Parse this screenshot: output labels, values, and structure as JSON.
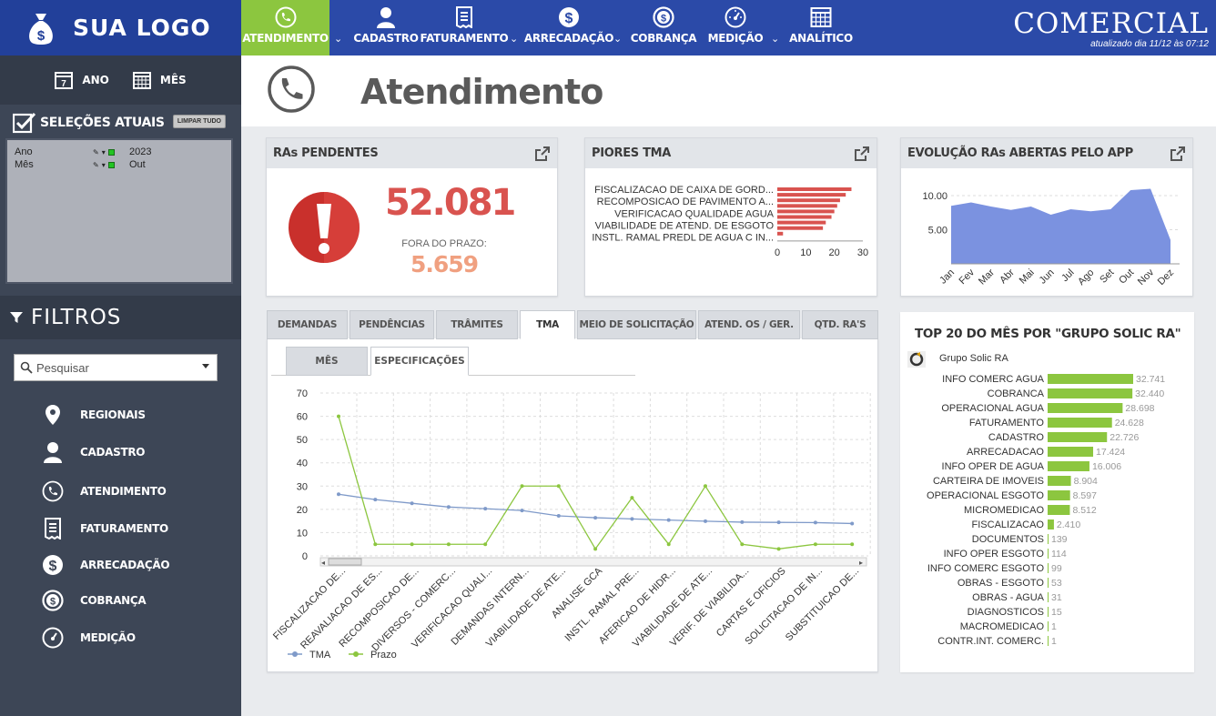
{
  "logo": {
    "text": "SUA LOGO"
  },
  "nav": {
    "items": [
      {
        "label": "ATENDIMENTO",
        "icon": "phone-icon",
        "active": true
      },
      {
        "label": "CADASTRO",
        "icon": "user-icon"
      },
      {
        "label": "FATURAMENTO",
        "icon": "receipt-icon"
      },
      {
        "label": "ARRECADAÇÃO",
        "icon": "dollar-icon"
      },
      {
        "label": "COBRANÇA",
        "icon": "dollar-cycle-icon"
      },
      {
        "label": "MEDIÇÃO",
        "icon": "gauge-icon"
      },
      {
        "label": "ANALÍTICO",
        "icon": "calendar-grid-icon"
      }
    ]
  },
  "app": {
    "title": "COMERCIAL",
    "updated": "atualizado dia 11/12 às 07:12"
  },
  "sidebar": {
    "ano": "ANO",
    "mes": "MÊS",
    "selections_title": "SELEÇÕES ATUAIS",
    "clear_label": "LIMPAR TUDO",
    "selections": [
      {
        "field": "Ano",
        "value": "2023"
      },
      {
        "field": "Mês",
        "value": "Out"
      }
    ],
    "filters_title": "FILTROS",
    "search_placeholder": "Pesquisar",
    "filters": [
      {
        "label": "REGIONAIS",
        "icon": "map-pin-icon"
      },
      {
        "label": "CADASTRO",
        "icon": "user-icon"
      },
      {
        "label": "ATENDIMENTO",
        "icon": "phone-icon"
      },
      {
        "label": "FATURAMENTO",
        "icon": "receipt-icon"
      },
      {
        "label": "ARRECADAÇÃO",
        "icon": "dollar-icon"
      },
      {
        "label": "COBRANÇA",
        "icon": "dollar-cycle-icon"
      },
      {
        "label": "MEDIÇÃO",
        "icon": "gauge-icon"
      }
    ]
  },
  "page": {
    "title": "Atendimento"
  },
  "kpi": {
    "title": "RAs PENDENTES",
    "value": "52.081",
    "sub_label": "FORA DO PRAZO:",
    "sub_value": "5.659"
  },
  "piores": {
    "title": "PIORES TMA"
  },
  "evolucao": {
    "title": "EVOLUÇÃO RAs ABERTAS PELO APP"
  },
  "tabs": [
    "DEMANDAS",
    "PENDÊNCIAS",
    "TRÂMITES",
    "TMA",
    "MEIO DE SOLICITAÇÃO",
    "ATEND. OS / GER.",
    "QTD. RA'S"
  ],
  "subtabs": [
    "MÊS",
    "ESPECIFICAÇÕES"
  ],
  "top20": {
    "title": "TOP 20 DO MÊS POR \"GRUPO SOLIC RA\"",
    "dimension": "Grupo Solic RA"
  },
  "colors": {
    "brand": "#2b4aa8",
    "accent": "#8cc63f",
    "alert": "#d9534f",
    "line_tma": "#7f9ac9",
    "area": "#7b92e0"
  },
  "chart_data": [
    {
      "type": "bar",
      "orientation": "horizontal",
      "title": "PIORES TMA",
      "categories": [
        "FISCALIZACAO DE CAIXA DE GORD...",
        "RECOMPOSICAO DE PAVIMENTO A...",
        "VERIFICACAO QUALIDADE AGUA",
        "VIABILIDADE DE ATEND. DE ESGOTO",
        "INSTL. RAMAL PREDL DE AGUA C IN...",
        "",
        "",
        "",
        ""
      ],
      "values": [
        26,
        24,
        22,
        21,
        20,
        19,
        17,
        16,
        2
      ],
      "xlim": [
        0,
        30
      ],
      "xticks": [
        "0",
        "10",
        "20",
        "30"
      ]
    },
    {
      "type": "area",
      "title": "EVOLUÇÃO RAs ABERTAS PELO APP",
      "categories": [
        "Jan",
        "Fev",
        "Mar",
        "Abr",
        "Mai",
        "Jun",
        "Jul",
        "Ago",
        "Set",
        "Out",
        "Nov",
        "Dez"
      ],
      "values": [
        8.5,
        9.0,
        8.4,
        7.9,
        8.4,
        7.2,
        8.0,
        7.7,
        8.0,
        10.8,
        11.0,
        3.5
      ],
      "ylim": [
        0,
        12
      ],
      "yticks": [
        "5.00",
        "10.00"
      ],
      "grid": true
    },
    {
      "type": "line",
      "title": "",
      "categories": [
        "FISCALIZACAO DE...",
        "REAVALIACAO DE ES...",
        "RECOMPOSICAO DE...",
        "DIVERSOS - COMERC...",
        "VERIFICACAO QUALI...",
        "DEMANDAS INTERN...",
        "VIABILIDADE DE ATE...",
        "ANALISE GCA",
        "INSTL. RAMAL PRE...",
        "AFERICAO DE HIDR...",
        "VIABILIDADE DE ATE...",
        "VERIF. DE VIABILIDA...",
        "CARTAS E OFICIOS",
        "SOLICITACAO DE IN...",
        "SUBSTITUICAO DE..."
      ],
      "series": [
        {
          "name": "TMA",
          "color": "#7f9ac9",
          "values": [
            26.5,
            24.2,
            22.6,
            21.0,
            20.3,
            19.5,
            17.2,
            16.4,
            15.9,
            15.4,
            14.9,
            14.5,
            14.4,
            14.3,
            13.9
          ]
        },
        {
          "name": "Prazo",
          "color": "#8cc63f",
          "values": [
            60,
            5,
            5,
            5,
            5,
            30,
            30,
            3,
            25,
            5,
            30,
            5,
            3,
            5,
            5
          ]
        }
      ],
      "ylim": [
        0,
        70
      ],
      "yticks": [
        "0",
        "10",
        "20",
        "30",
        "40",
        "50",
        "60",
        "70"
      ],
      "grid": true,
      "legend": "bottom-left"
    },
    {
      "type": "bar",
      "orientation": "horizontal",
      "title": "TOP 20 DO MÊS POR \"GRUPO SOLIC RA\"",
      "categories": [
        "INFO COMERC AGUA",
        "COBRANCA",
        "OPERACIONAL AGUA",
        "FATURAMENTO",
        "CADASTRO",
        "ARRECADACAO",
        "INFO OPER DE AGUA",
        "CARTEIRA DE IMOVEIS",
        "OPERACIONAL ESGOTO",
        "MICROMEDICAO",
        "FISCALIZACAO",
        "DOCUMENTOS",
        "INFO OPER ESGOTO",
        "INFO COMERC ESGOTO",
        "OBRAS - ESGOTO",
        "OBRAS - AGUA",
        "DIAGNOSTICOS",
        "MACROMEDICAO",
        "CONTR.INT. COMERC."
      ],
      "values": [
        32741,
        32440,
        28698,
        24628,
        22726,
        17424,
        16006,
        8904,
        8597,
        8512,
        2410,
        139,
        114,
        99,
        53,
        31,
        15,
        1,
        1
      ],
      "labels": [
        "32.741",
        "32.440",
        "28.698",
        "24.628",
        "22.726",
        "17.424",
        "16.006",
        "8.904",
        "8.597",
        "8.512",
        "2.410",
        "139",
        "114",
        "99",
        "53",
        "31",
        "15",
        "1",
        "1"
      ]
    }
  ]
}
